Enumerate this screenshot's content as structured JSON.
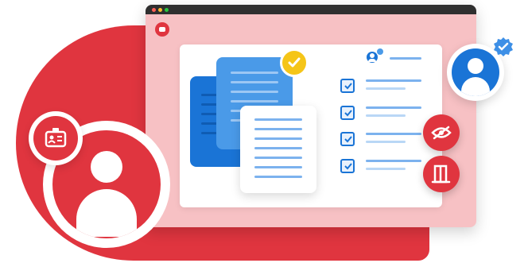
{
  "colors": {
    "brand_red": "#e0353f",
    "window_bg": "#f7c1c4",
    "doc_blue_dark": "#1a74d6",
    "doc_blue_light": "#4a9ae8",
    "check_badge": "#f5c518",
    "verified_badge": "#3d8fe6",
    "titlebar": "#2f2f2f"
  },
  "icons": {
    "app_logo": "video-icon",
    "document_check": "check-icon",
    "id_card": "id-card-icon",
    "user_avatar": "user-icon",
    "verified": "verified-badge-icon",
    "hide": "eye-off-icon",
    "exit": "door-exit-icon",
    "checkbox": "checkbox-checked-icon"
  },
  "checklist": {
    "items": [
      {
        "checked": true
      },
      {
        "checked": true
      },
      {
        "checked": true
      },
      {
        "checked": true
      }
    ]
  }
}
